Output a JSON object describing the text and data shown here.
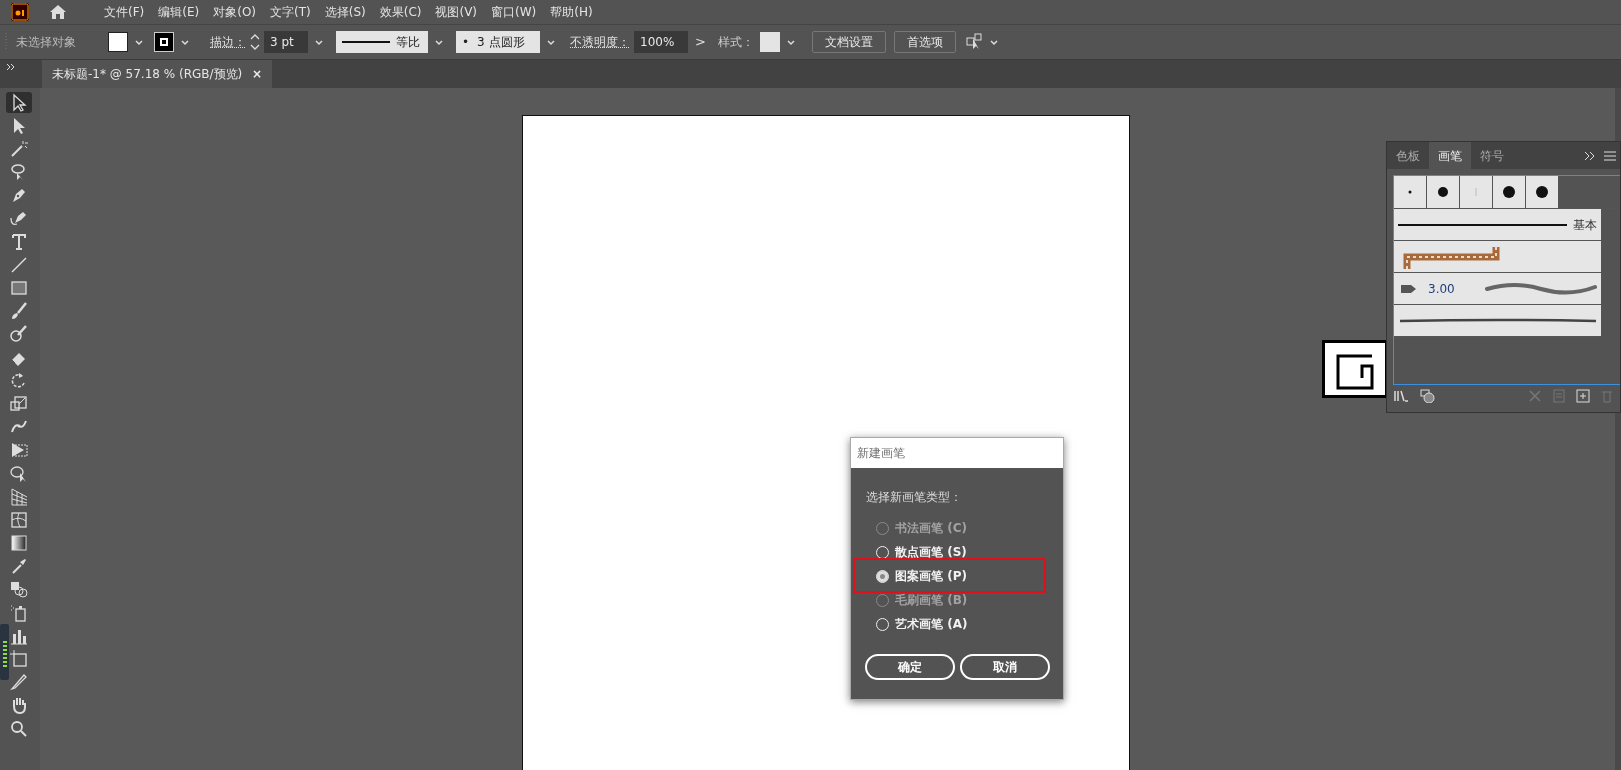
{
  "menu_bar": {
    "items": [
      "文件(F)",
      "编辑(E)",
      "对象(O)",
      "文字(T)",
      "选择(S)",
      "效果(C)",
      "视图(V)",
      "窗口(W)",
      "帮助(H)"
    ]
  },
  "control_bar": {
    "selection_status": "未选择对象",
    "stroke_label": "描边：",
    "stroke_weight": "3 pt",
    "stroke_profile": "等比",
    "brush_dot": "•",
    "brush": "3 点圆形",
    "opacity_label": "不透明度：",
    "opacity": "100%",
    "opacity_arrow": ">",
    "style_label": "样式：",
    "buttons": [
      "文档设置",
      "首选项"
    ]
  },
  "document_tab": {
    "title": "未标题-1* @ 57.18 % (RGB/预览)",
    "close": "×"
  },
  "tools": [
    {
      "kind": "selection",
      "selected": true
    },
    {
      "kind": "direct",
      "selected": false
    },
    {
      "kind": "wand",
      "selected": false
    },
    {
      "kind": "lasso",
      "selected": false
    },
    {
      "kind": "pen",
      "selected": false
    },
    {
      "kind": "curvature",
      "selected": false
    },
    {
      "kind": "type",
      "selected": false
    },
    {
      "kind": "line",
      "selected": false
    },
    {
      "kind": "rectangle",
      "selected": false
    },
    {
      "kind": "brush",
      "selected": false
    },
    {
      "kind": "blob",
      "selected": false
    },
    {
      "kind": "eraser",
      "selected": false
    },
    {
      "kind": "rotate",
      "selected": false
    },
    {
      "kind": "scale",
      "selected": false
    },
    {
      "kind": "warp",
      "selected": false
    },
    {
      "kind": "transform",
      "selected": false
    },
    {
      "kind": "builder",
      "selected": false
    },
    {
      "kind": "perspective",
      "selected": false
    },
    {
      "kind": "mesh",
      "selected": false
    },
    {
      "kind": "gradient",
      "selected": false
    },
    {
      "kind": "eyedropper",
      "selected": false
    },
    {
      "kind": "blend",
      "selected": false
    },
    {
      "kind": "sprayer",
      "selected": false
    },
    {
      "kind": "graph",
      "selected": false
    },
    {
      "kind": "artboard",
      "selected": false
    },
    {
      "kind": "knife",
      "selected": false
    },
    {
      "kind": "hand",
      "selected": false
    },
    {
      "kind": "zoom",
      "selected": false
    }
  ],
  "brushes_panel": {
    "tabs": [
      {
        "label": "色板",
        "selected": false
      },
      {
        "label": "画笔",
        "selected": true
      },
      {
        "label": "符号",
        "selected": false
      }
    ],
    "rows": [
      {
        "kind": "dots"
      },
      {
        "kind": "basic",
        "label": "基本"
      },
      {
        "kind": "pattern"
      },
      {
        "kind": "art",
        "label": "3.00"
      },
      {
        "kind": "charcoal"
      }
    ]
  },
  "dialog": {
    "title": "新建画笔",
    "prompt": "选择新画笔类型：",
    "options": [
      {
        "label": "书法画笔 (C)",
        "selected": false,
        "disabled": true,
        "highlighted": false
      },
      {
        "label": "散点画笔 (S)",
        "selected": false,
        "disabled": false,
        "highlighted": false
      },
      {
        "label": "图案画笔 (P)",
        "selected": true,
        "disabled": false,
        "highlighted": true
      },
      {
        "label": "毛刷画笔 (B)",
        "selected": false,
        "disabled": true,
        "highlighted": false
      },
      {
        "label": "艺术画笔 (A)",
        "selected": false,
        "disabled": false,
        "highlighted": false
      }
    ],
    "buttons": [
      "确定",
      "取消"
    ]
  }
}
